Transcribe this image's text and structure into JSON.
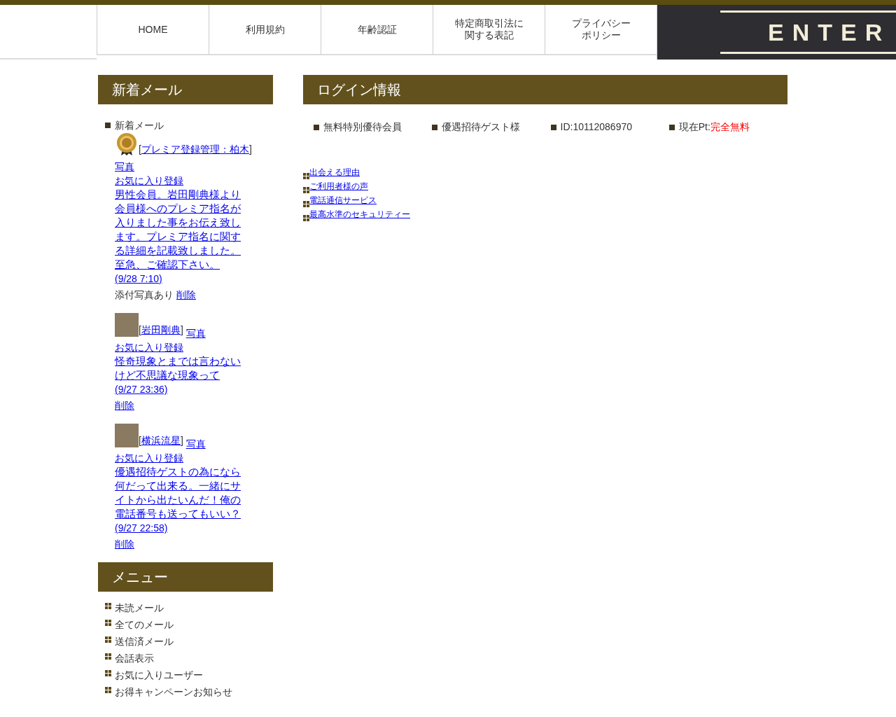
{
  "nav": {
    "items": [
      {
        "label": "HOME"
      },
      {
        "label": "利用規約"
      },
      {
        "label": "年齢認証"
      },
      {
        "label": "特定商取引法に",
        "label_2": "関する表記"
      },
      {
        "label": "プライバシー",
        "label_2": "ポリシー"
      }
    ],
    "logo": "ENTER"
  },
  "new_mail": {
    "title": "新着メール",
    "heading": "新着メール",
    "mails": [
      {
        "kind": "badge",
        "open": "[",
        "sender": "プレミア登録管理：柏木",
        "close": "]",
        "photo_link": "写真",
        "favorite_link": "お気に入り登録",
        "body": "男性会員。岩田剛典様より会員様へのプレミア指名が入りました事をお伝え致します。プレミア指名に関する詳細を記載致しました。至急、ご確認下さい。",
        "time": "(9/28 7:10)",
        "attachment": "添付写真あり",
        "delete_link": "削除"
      },
      {
        "kind": "photo",
        "open": "[",
        "sender": "岩田剛典",
        "close": "]",
        "photo_link": "写真",
        "favorite_link": "お気に入り登録",
        "body": "怪奇現象とまでは言わないけど不思議な現象って",
        "time": "(9/27 23:36)",
        "delete_link": "削除"
      },
      {
        "kind": "photo",
        "open": "[",
        "sender": "横浜流星",
        "close": "]",
        "photo_link": "写真",
        "favorite_link": "お気に入り登録",
        "body": "優遇招待ゲストの為になら何だって出来る。一緒にサイトから出たいんだ！俺の電話番号も送ってもいい？",
        "time": "(9/27 22:58)",
        "delete_link": "削除"
      }
    ]
  },
  "menu": {
    "title": "メニュー",
    "items": [
      "未読メール",
      "全てのメール",
      "送信済メール",
      "会話表示",
      "お気に入りユーザー",
      "お得キャンペーンお知らせ"
    ]
  },
  "login_info": {
    "title": "ログイン情報",
    "items": [
      {
        "text": "無料特別優待会員"
      },
      {
        "text": "優遇招待ゲスト様"
      },
      {
        "text": "ID:10112086970"
      },
      {
        "text": "現在Pt:",
        "highlight": "完全無料"
      }
    ],
    "links": [
      "出会える理由",
      "ご利用者様の声",
      "電話通信サービス",
      "最高水準のセキュリティー"
    ]
  }
}
